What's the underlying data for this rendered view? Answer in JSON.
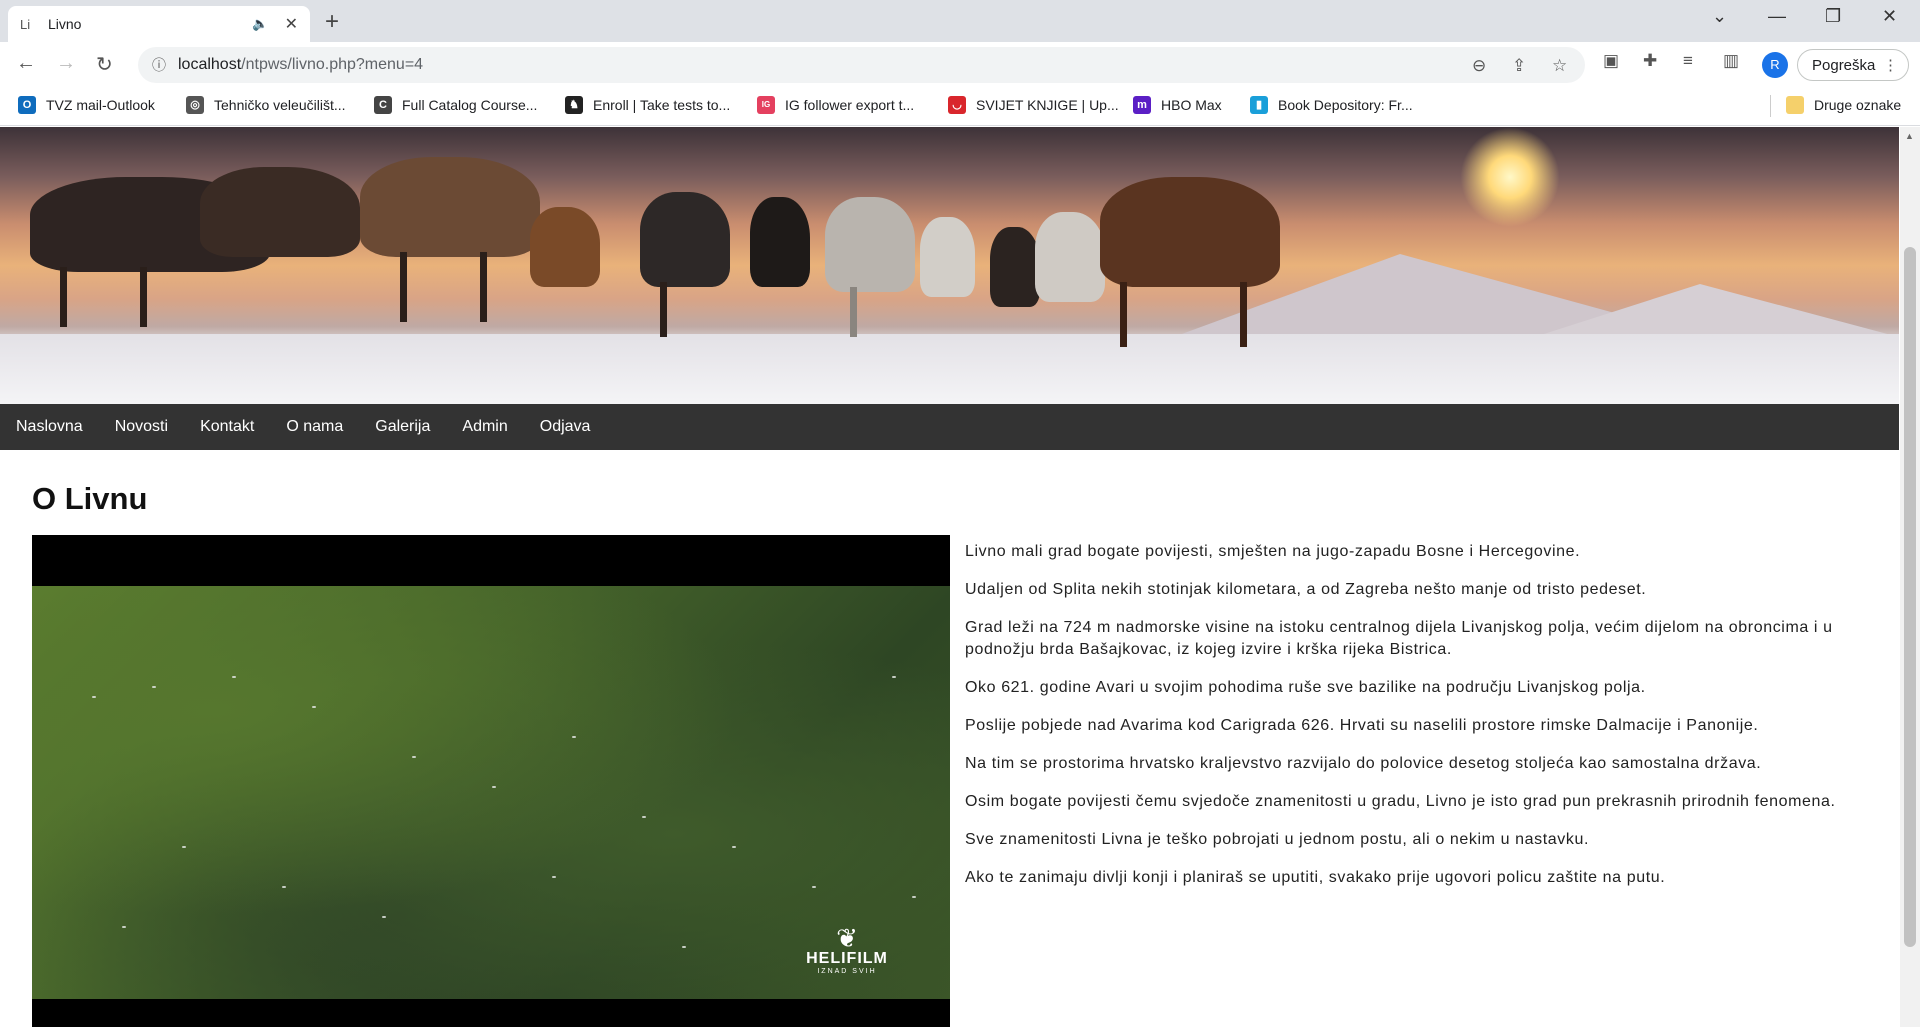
{
  "browser": {
    "tab_title": "Livno",
    "tab_favicon": "Li",
    "url_host": "localhost",
    "url_path": "/ntpws/livno.php?menu=4",
    "profile_initial": "R",
    "error_label": "Pogreška",
    "bookmarks": [
      {
        "label": "TVZ mail-Outlook",
        "color": "#0f6cbd",
        "icon": "O"
      },
      {
        "label": "Tehničko veleučilišt...",
        "color": "#555555",
        "icon": "◎"
      },
      {
        "label": "Full Catalog Course...",
        "color": "#444444",
        "icon": "C"
      },
      {
        "label": "Enroll | Take tests to...",
        "color": "#222222",
        "icon": "♞"
      },
      {
        "label": "IG follower export t...",
        "color": "#e4405f",
        "icon": "IG"
      },
      {
        "label": "SVIJET KNJIGE | Up...",
        "color": "#d9262c",
        "icon": "◡"
      },
      {
        "label": "HBO Max",
        "color": "#5b1fc5",
        "icon": "m"
      },
      {
        "label": "Book Depository: Fr...",
        "color": "#1a9fd9",
        "icon": "▮"
      }
    ],
    "other_bookmarks": "Druge oznake"
  },
  "nav": {
    "items": [
      "Naslovna",
      "Novosti",
      "Kontakt",
      "O nama",
      "Galerija",
      "Admin",
      "Odjava"
    ]
  },
  "page": {
    "title": "O Livnu",
    "video_logo": "HELIFILM",
    "video_logo_sub": "IZNAD SVIH",
    "paragraphs": [
      "Livno mali grad bogate povijesti, smješten na jugo-zapadu Bosne i Hercegovine.",
      "Udaljen od Splita nekih stotinjak kilometara, a od Zagreba nešto manje od tristo pedeset.",
      "Grad leži na 724 m nadmorske visine na istoku centralnog dijela Livanjskog polja, većim dijelom na obroncima i u podnožju brda Bašajkovac, iz kojeg izvire i krška rijeka Bistrica.",
      "Oko 621. godine Avari u svojim pohodima ruše sve bazilike na području Livanjskog polja.",
      "Poslije pobjede nad Avarima kod Carigrada 626. Hrvati su naselili prostore rimske Dalmacije i Panonije.",
      "Na tim se prostorima hrvatsko kraljevstvo razvijalo do polovice desetog stoljeća kao samostalna država.",
      "Osim bogate povijesti čemu svjedoče znamenitosti u gradu, Livno je isto grad pun prekrasnih prirodnih fenomena.",
      "Sve znamenitosti Livna je teško pobrojati u jednom postu, ali o nekim u nastavku.",
      "Ako te zanimaju divlji konji i planiraš se uputiti, svakako prije ugovori policu zaštite na putu."
    ]
  }
}
